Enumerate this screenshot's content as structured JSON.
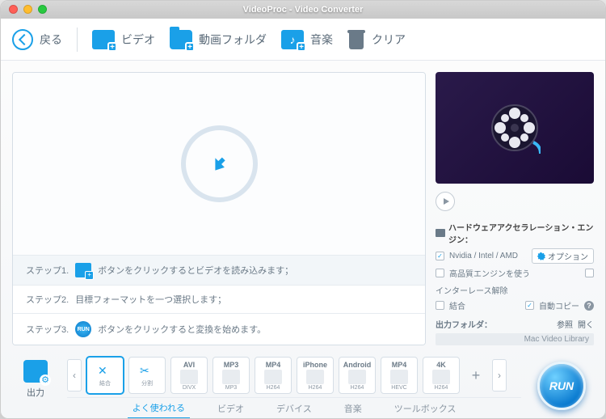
{
  "window": {
    "title": "VideoProc - Video Converter"
  },
  "toolbar": {
    "back": "戻る",
    "video": "ビデオ",
    "folder": "動画フォルダ",
    "music": "音楽",
    "clear": "クリア"
  },
  "steps": {
    "s1_label": "ステップ1.",
    "s1_text": "ボタンをクリックするとビデオを読み込みます；",
    "s2_label": "ステップ2.",
    "s2_text": "目標フォーマットを一つ選択します；",
    "s3_label": "ステップ3.",
    "s3_text": "ボタンをクリックすると変換を始めます。",
    "run_icon": "RUN"
  },
  "side": {
    "hw_title": "ハードウェアアクセラレーション・エンジン：",
    "nvidia": "Nvidia / Intel / AMD",
    "option": "オプション",
    "hq": "高品質エンジンを使う",
    "deint": "インターレース解除",
    "merge": "結合",
    "autocopy": "自動コピー",
    "out_folder_label": "出力フォルダ：",
    "browse": "参照",
    "open": "開く",
    "folder_path": "Mac Video Library"
  },
  "output_label": "出力",
  "formats": [
    {
      "main": "",
      "sub": "結合",
      "selected": true,
      "tool": "✂"
    },
    {
      "main": "",
      "sub": "分割",
      "tool": "✂"
    },
    {
      "main": "AVI",
      "sub": "DIVX"
    },
    {
      "main": "MP3",
      "sub": "MP3"
    },
    {
      "main": "MP4",
      "sub": "H264"
    },
    {
      "main": "iPhone",
      "sub": "H264"
    },
    {
      "main": "Android",
      "sub": "H264"
    },
    {
      "main": "MP4",
      "sub": "HEVC"
    },
    {
      "main": "4K",
      "sub": "H264"
    }
  ],
  "tabs": {
    "popular": "よく使われる",
    "video": "ビデオ",
    "device": "デバイス",
    "music": "音楽",
    "toolbox": "ツールボックス"
  },
  "run": "RUN"
}
